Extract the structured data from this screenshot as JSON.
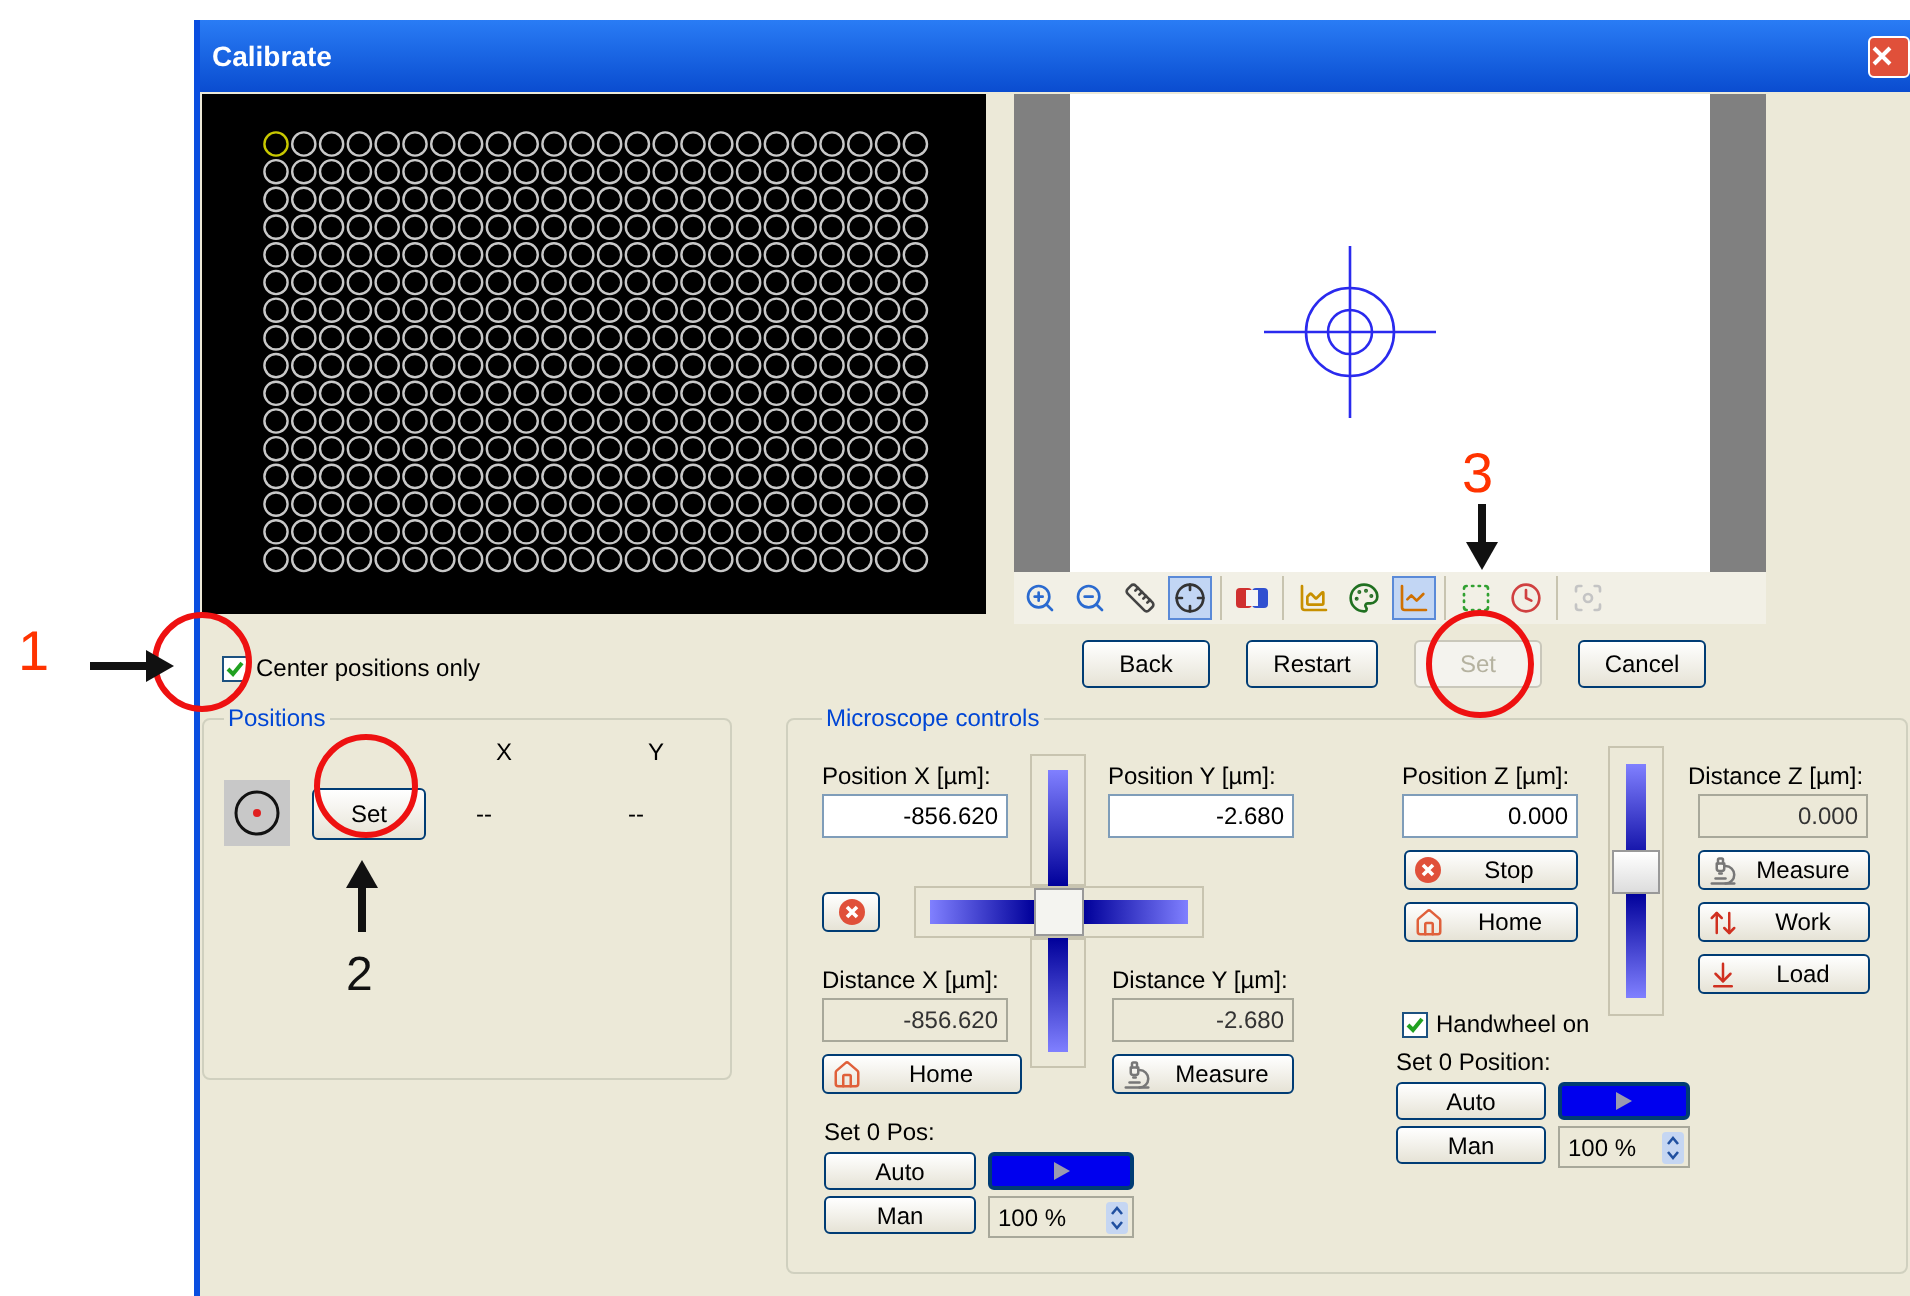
{
  "window": {
    "title": "Calibrate"
  },
  "toolbar_groups": [
    [
      {
        "kind": "zoom-in",
        "selected": false,
        "disabled": false
      },
      {
        "kind": "zoom-out",
        "selected": false,
        "disabled": false
      },
      {
        "kind": "ruler",
        "selected": false,
        "disabled": false
      },
      {
        "kind": "crosshair",
        "selected": true,
        "disabled": false
      }
    ],
    [
      {
        "kind": "color-strip",
        "selected": false,
        "disabled": false
      }
    ],
    [
      {
        "kind": "chart",
        "selected": false,
        "disabled": false
      },
      {
        "kind": "palette",
        "selected": false,
        "disabled": false
      },
      {
        "kind": "chart-pen",
        "selected": true,
        "disabled": false
      }
    ],
    [
      {
        "kind": "frame",
        "selected": false,
        "disabled": false
      },
      {
        "kind": "clock",
        "selected": false,
        "disabled": false
      }
    ],
    [
      {
        "kind": "autofocus",
        "selected": false,
        "disabled": true
      }
    ]
  ],
  "dialog_buttons": [
    {
      "label": "Back",
      "disabled": false
    },
    {
      "label": "Restart",
      "disabled": false
    },
    {
      "label": "Set",
      "disabled": true
    },
    {
      "label": "Cancel",
      "disabled": false
    }
  ],
  "center_positions_only": {
    "label": "Center positions only",
    "checked": true
  },
  "positions": {
    "title": "Positions",
    "columns": [
      "X",
      "Y"
    ],
    "set_button": "Set",
    "values": [
      "--",
      "--"
    ]
  },
  "microscope": {
    "title": "Microscope controls",
    "position_x": {
      "label": "Position X [µm]:",
      "value": "-856.620"
    },
    "position_y": {
      "label": "Position Y [µm]:",
      "value": "-2.680"
    },
    "distance_x": {
      "label": "Distance X [µm]:",
      "value": "-856.620"
    },
    "distance_y": {
      "label": "Distance Y [µm]:",
      "value": "-2.680"
    },
    "xy_buttons": [
      {
        "kind": "home",
        "label": "Home"
      },
      {
        "kind": "measure",
        "label": "Measure"
      }
    ],
    "xy_zero": {
      "label": "Set 0 Pos:",
      "auto": "Auto",
      "man": "Man",
      "speed": "100 %"
    },
    "position_z": {
      "label": "Position Z [µm]:",
      "value": "0.000"
    },
    "distance_z": {
      "label": "Distance Z [µm]:",
      "value": "0.000"
    },
    "z_left_buttons": [
      {
        "kind": "stop",
        "label": "Stop"
      },
      {
        "kind": "home",
        "label": "Home"
      }
    ],
    "z_slider": {
      "level": 0.55
    },
    "z_right_buttons": [
      {
        "kind": "measure",
        "label": "Measure"
      },
      {
        "kind": "work",
        "label": "Work"
      },
      {
        "kind": "load",
        "label": "Load"
      }
    ],
    "handwheel": {
      "label": "Handwheel on",
      "checked": true
    },
    "z_zero": {
      "label": "Set 0 Position:",
      "auto": "Auto",
      "man": "Man",
      "speed": "100 %"
    }
  },
  "annotations": [
    {
      "label": "1",
      "color": "#ff3300"
    },
    {
      "label": "2",
      "color": "#111111"
    },
    {
      "label": "3",
      "color": "#ff3300"
    }
  ]
}
